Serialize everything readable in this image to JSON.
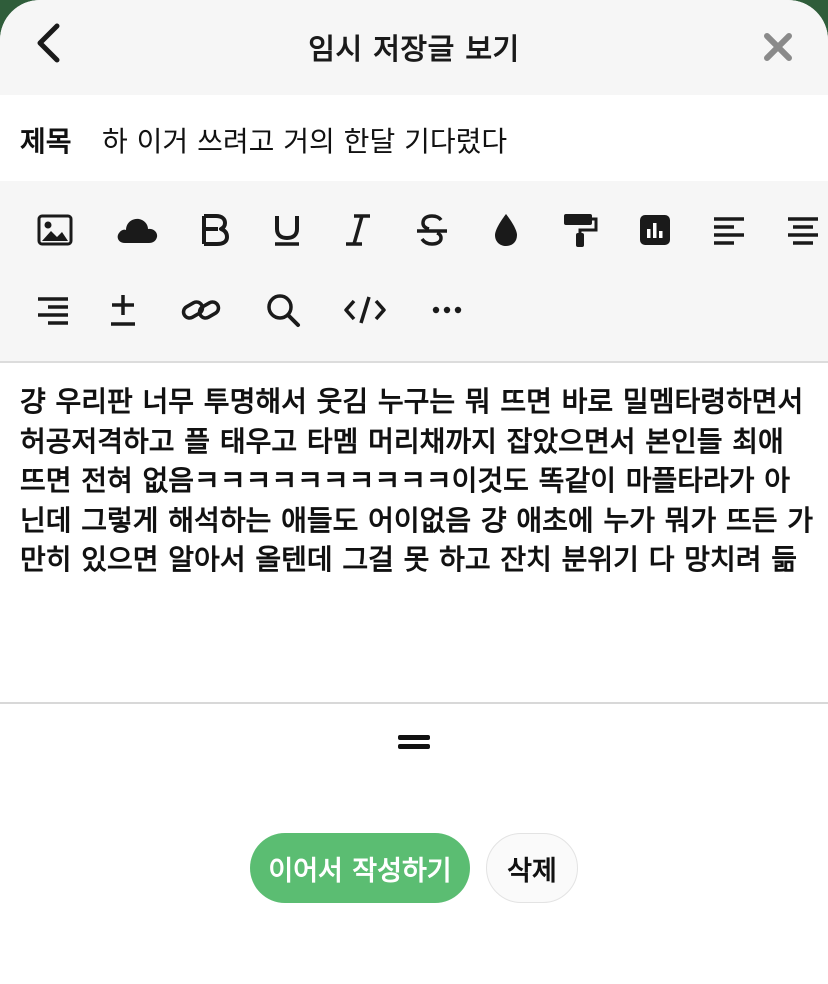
{
  "header": {
    "title": "임시 저장글 보기",
    "back_icon": "chevron-left-icon",
    "close_icon": "close-icon"
  },
  "post": {
    "title_label": "제목",
    "title_value": "하 이거 쓰려고 거의 한달 기다렸다",
    "body": "걍 우리판 너무 투명해서 웃김 누구는 뭐 뜨면 바로 밀멤타령하면서 허공저격하고 플 태우고 타멤 머리채까지 잡았으면서 본인들 최애 뜨면 전혀 없음ㅋㅋㅋㅋㅋㅋㅋㅋㅋㅋ이것도 똑같이 마플타라가 아닌데 그렇게 해석하는 애들도 어이없음 걍 애초에 누가 뭐가 뜨든 가만히 있으면 알아서 올텐데 그걸 못 하고 잔치 분위기 다 망치려 듦"
  },
  "toolbar": {
    "tools": [
      "image-icon",
      "cloud-icon",
      "bold-icon",
      "underline-icon",
      "italic-icon",
      "strikethrough-icon",
      "text-color-icon",
      "paint-roller-icon",
      "chart-icon",
      "align-left-icon",
      "align-center-icon",
      "align-right-icon",
      "plus-minus-icon",
      "link-icon",
      "search-icon",
      "code-icon",
      "more-icon"
    ]
  },
  "actions": {
    "continue_label": "이어서 작성하기",
    "delete_label": "삭제"
  },
  "colors": {
    "accent_green": "#5bbd72",
    "background_green": "#2f5d3a",
    "icon_dark": "#1a1a1a"
  }
}
